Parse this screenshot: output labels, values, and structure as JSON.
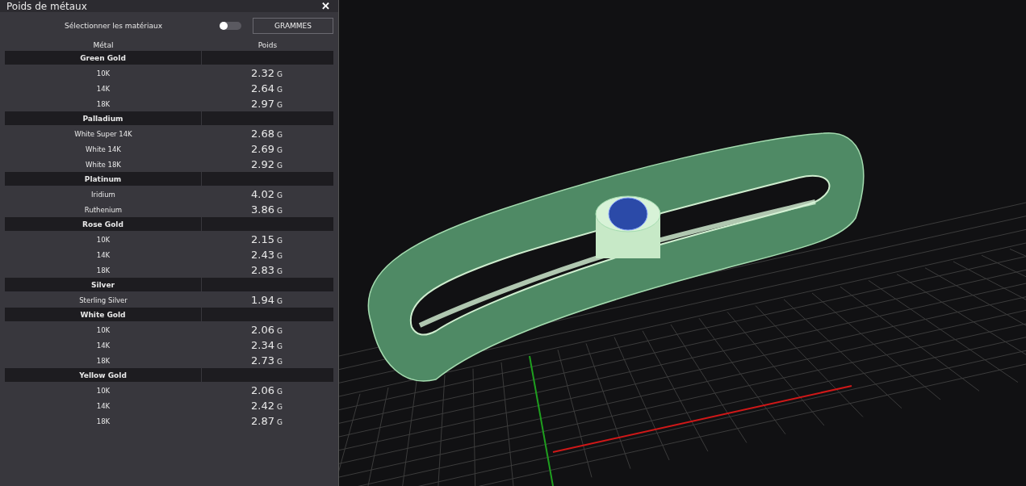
{
  "panel": {
    "title": "Poids de métaux",
    "close": "✕"
  },
  "controls": {
    "label": "Sélectionner les matériaux",
    "toggle_on": false,
    "unit_button": "GRAMMES"
  },
  "table": {
    "columns": [
      "Métal",
      "Poids"
    ],
    "groups": [
      {
        "name": "Green Gold",
        "rows": [
          {
            "metal": "10K",
            "weight": "2.32",
            "unit": "G"
          },
          {
            "metal": "14K",
            "weight": "2.64",
            "unit": "G"
          },
          {
            "metal": "18K",
            "weight": "2.97",
            "unit": "G"
          }
        ]
      },
      {
        "name": "Palladium",
        "rows": [
          {
            "metal": "White Super 14K",
            "weight": "2.68",
            "unit": "G"
          },
          {
            "metal": "White 14K",
            "weight": "2.69",
            "unit": "G"
          },
          {
            "metal": "White 18K",
            "weight": "2.92",
            "unit": "G"
          }
        ]
      },
      {
        "name": "Platinum",
        "rows": [
          {
            "metal": "Iridium",
            "weight": "4.02",
            "unit": "G"
          },
          {
            "metal": "Ruthenium",
            "weight": "3.86",
            "unit": "G"
          }
        ]
      },
      {
        "name": "Rose Gold",
        "rows": [
          {
            "metal": "10K",
            "weight": "2.15",
            "unit": "G"
          },
          {
            "metal": "14K",
            "weight": "2.43",
            "unit": "G"
          },
          {
            "metal": "18K",
            "weight": "2.83",
            "unit": "G"
          }
        ]
      },
      {
        "name": "Silver",
        "rows": [
          {
            "metal": "Sterling Silver",
            "weight": "1.94",
            "unit": "G"
          }
        ]
      },
      {
        "name": "White Gold",
        "rows": [
          {
            "metal": "10K",
            "weight": "2.06",
            "unit": "G"
          },
          {
            "metal": "14K",
            "weight": "2.34",
            "unit": "G"
          },
          {
            "metal": "18K",
            "weight": "2.73",
            "unit": "G"
          }
        ]
      },
      {
        "name": "Yellow Gold",
        "rows": [
          {
            "metal": "10K",
            "weight": "2.06",
            "unit": "G"
          },
          {
            "metal": "14K",
            "weight": "2.42",
            "unit": "G"
          },
          {
            "metal": "18K",
            "weight": "2.87",
            "unit": "G"
          }
        ]
      }
    ]
  }
}
